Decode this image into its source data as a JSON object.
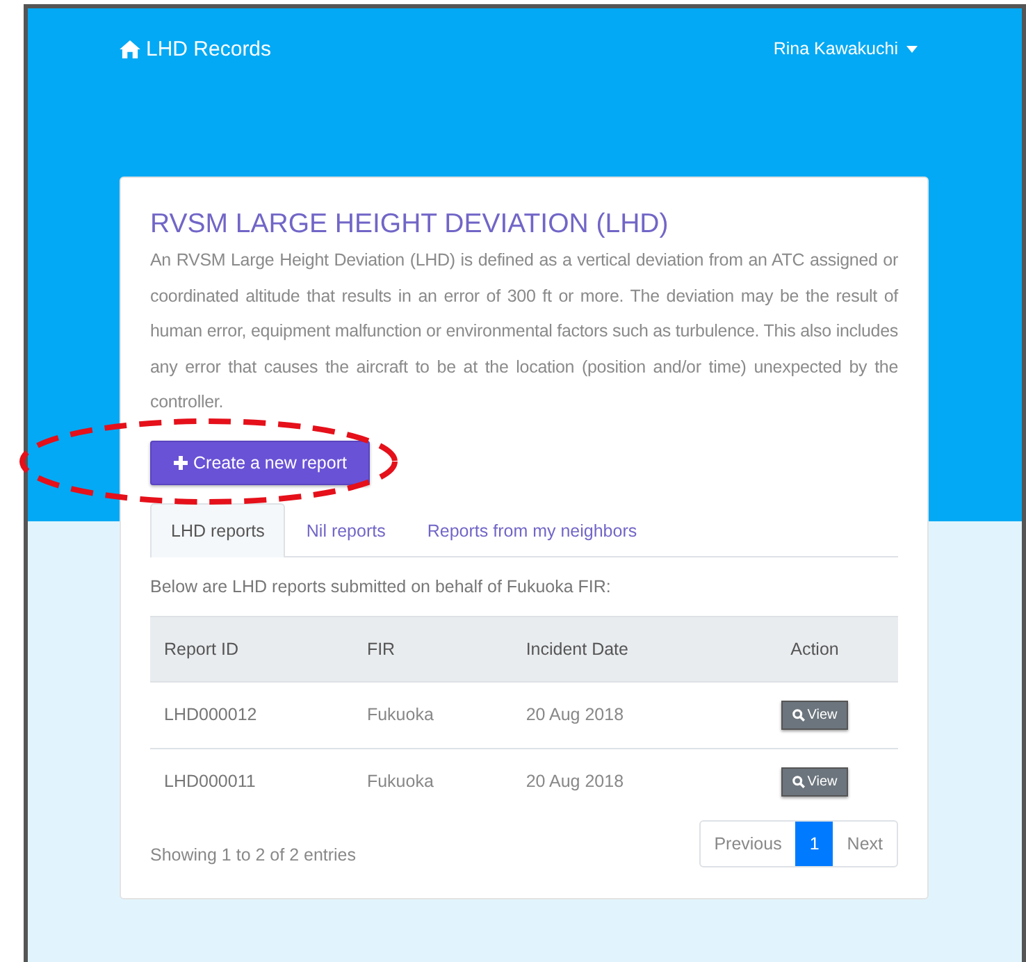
{
  "navbar": {
    "brand": "LHD Records",
    "user": "Rina Kawakuchi"
  },
  "card": {
    "title": "RVSM LARGE HEIGHT DEVIATION (LHD)",
    "description": "An RVSM Large Height Deviation (LHD) is defined as a vertical deviation from an ATC assigned or coordinated altitude that results in an error of 300 ft or more. The deviation may be the result of human error, equipment malfunction or environmental factors such as turbulence. This also includes any error that causes the aircraft to be at the location (position and/or time) unexpected by the controller.",
    "create_button": "Create a new report"
  },
  "tabs": [
    {
      "label": "LHD reports",
      "selected": true
    },
    {
      "label": "Nil reports",
      "selected": false
    },
    {
      "label": "Reports from my neighbors",
      "selected": false
    }
  ],
  "intro": "Below are LHD reports submitted on behalf of Fukuoka FIR:",
  "table": {
    "columns": [
      "Report ID",
      "FIR",
      "Incident Date",
      "Action"
    ],
    "rows": [
      {
        "id": "LHD000012",
        "fir": "Fukuoka",
        "date": "20 Aug 2018",
        "action": "View"
      },
      {
        "id": "LHD000011",
        "fir": "Fukuoka",
        "date": "20 Aug 2018",
        "action": "View"
      }
    ]
  },
  "footer": {
    "info": "Showing 1 to 2 of 2 entries",
    "pagination": [
      {
        "label": "Previous",
        "selected": false
      },
      {
        "label": "1",
        "selected": true
      },
      {
        "label": "Next",
        "selected": false
      }
    ]
  }
}
